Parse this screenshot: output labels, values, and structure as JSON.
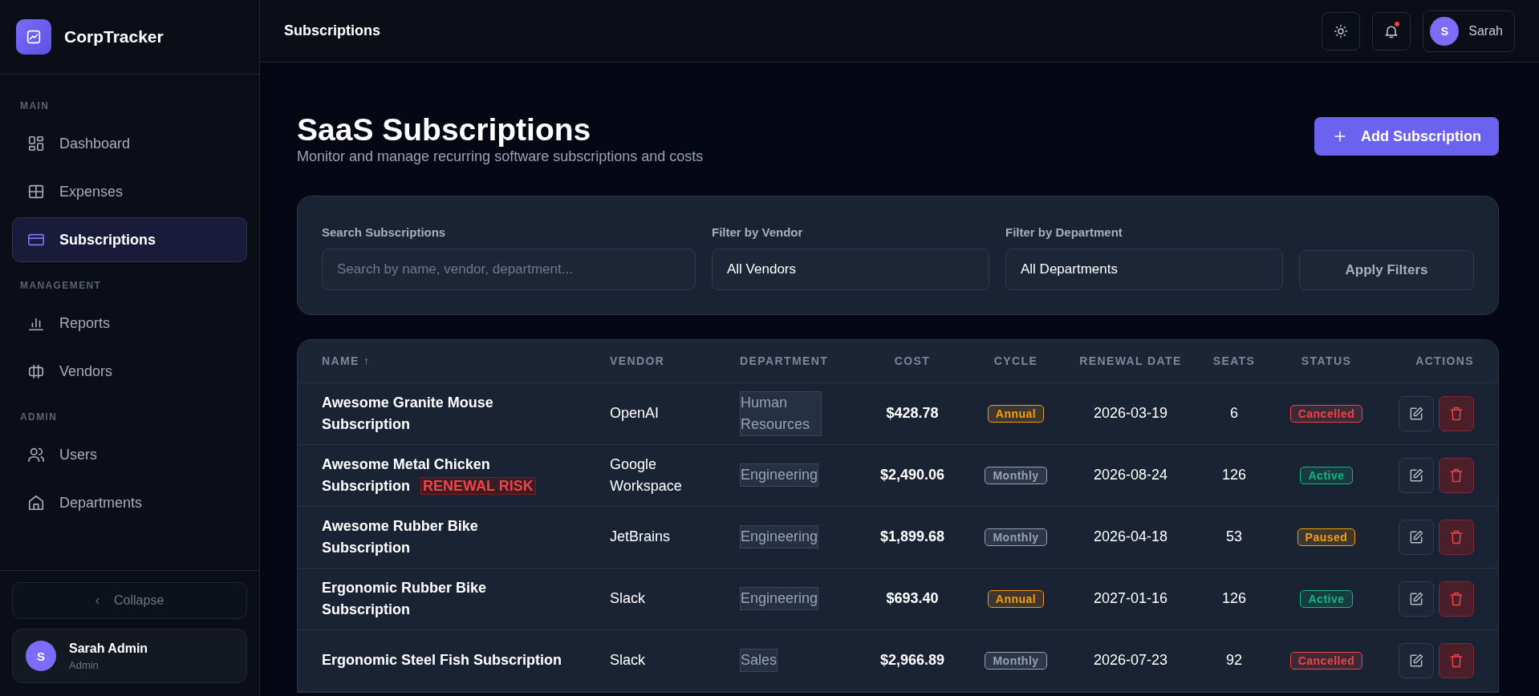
{
  "brand": {
    "name": "CorpTracker"
  },
  "sidebar": {
    "sections": [
      {
        "heading": "MAIN",
        "items": [
          {
            "label": "Dashboard",
            "selected": false
          },
          {
            "label": "Expenses",
            "selected": false
          },
          {
            "label": "Subscriptions",
            "selected": true
          }
        ]
      },
      {
        "heading": "MANAGEMENT",
        "items": [
          {
            "label": "Reports",
            "selected": false
          },
          {
            "label": "Vendors",
            "selected": false
          }
        ]
      },
      {
        "heading": "ADMIN",
        "items": [
          {
            "label": "Users",
            "selected": false
          },
          {
            "label": "Departments",
            "selected": false
          }
        ]
      }
    ],
    "collapse": {
      "arrow": "‹",
      "label": "Collapse"
    },
    "user": {
      "initial": "S",
      "name": "Sarah Admin",
      "role": "Admin"
    }
  },
  "header": {
    "title": "Subscriptions",
    "notifications_unread": true,
    "user": {
      "initial": "S",
      "name": "Sarah"
    }
  },
  "page": {
    "title": "SaaS Subscriptions",
    "subtitle": "Monitor and manage recurring software subscriptions and costs",
    "add_button": "Add Subscription"
  },
  "filters": {
    "search": {
      "label": "Search Subscriptions",
      "placeholder": "Search by name, vendor, department..."
    },
    "vendor": {
      "label": "Filter by Vendor",
      "value": "All Vendors"
    },
    "department": {
      "label": "Filter by Department",
      "value": "All Departments"
    },
    "apply_button": "Apply Filters"
  },
  "table": {
    "columns": [
      {
        "label": "NAME",
        "sort_mark": "↑"
      },
      {
        "label": "VENDOR"
      },
      {
        "label": "DEPARTMENT"
      },
      {
        "label": "COST"
      },
      {
        "label": "CYCLE"
      },
      {
        "label": "RENEWAL DATE"
      },
      {
        "label": "SEATS"
      },
      {
        "label": "STATUS"
      },
      {
        "label": "ACTIONS"
      }
    ],
    "rows": [
      {
        "name": "Awesome Granite Mouse Subscription",
        "vendor": "OpenAI",
        "department": "Human Resources",
        "cost": "$428.78",
        "cycle": {
          "label": "Annual",
          "color": "#f59e0b"
        },
        "renewal": "2026-03-19",
        "seats": "6",
        "status": {
          "label": "Cancelled",
          "color": "#ef4444"
        }
      },
      {
        "name": "Awesome Metal Chicken Subscription",
        "flag": "RENEWAL RISK",
        "vendor": "Google Workspace",
        "department": "Engineering",
        "cost": "$2,490.06",
        "cycle": {
          "label": "Monthly",
          "color": "#94a3b8"
        },
        "renewal": "2026-08-24",
        "seats": "126",
        "status": {
          "label": "Active",
          "color": "#10b981"
        }
      },
      {
        "name": "Awesome Rubber Bike Subscription",
        "vendor": "JetBrains",
        "department": "Engineering",
        "cost": "$1,899.68",
        "cycle": {
          "label": "Monthly",
          "color": "#94a3b8"
        },
        "renewal": "2026-04-18",
        "seats": "53",
        "status": {
          "label": "Paused",
          "color": "#f59e0b"
        }
      },
      {
        "name": "Ergonomic Rubber Bike Subscription",
        "vendor": "Slack",
        "department": "Engineering",
        "cost": "$693.40",
        "cycle": {
          "label": "Annual",
          "color": "#f59e0b"
        },
        "renewal": "2027-01-16",
        "seats": "126",
        "status": {
          "label": "Active",
          "color": "#10b981"
        }
      },
      {
        "name": "Ergonomic Steel Fish Subscription",
        "vendor": "Slack",
        "department": "Sales",
        "cost": "$2,966.89",
        "cycle": {
          "label": "Monthly",
          "color": "#94a3b8"
        },
        "renewal": "2026-07-23",
        "seats": "92",
        "status": {
          "label": "Cancelled",
          "color": "#ef4444"
        }
      }
    ]
  }
}
